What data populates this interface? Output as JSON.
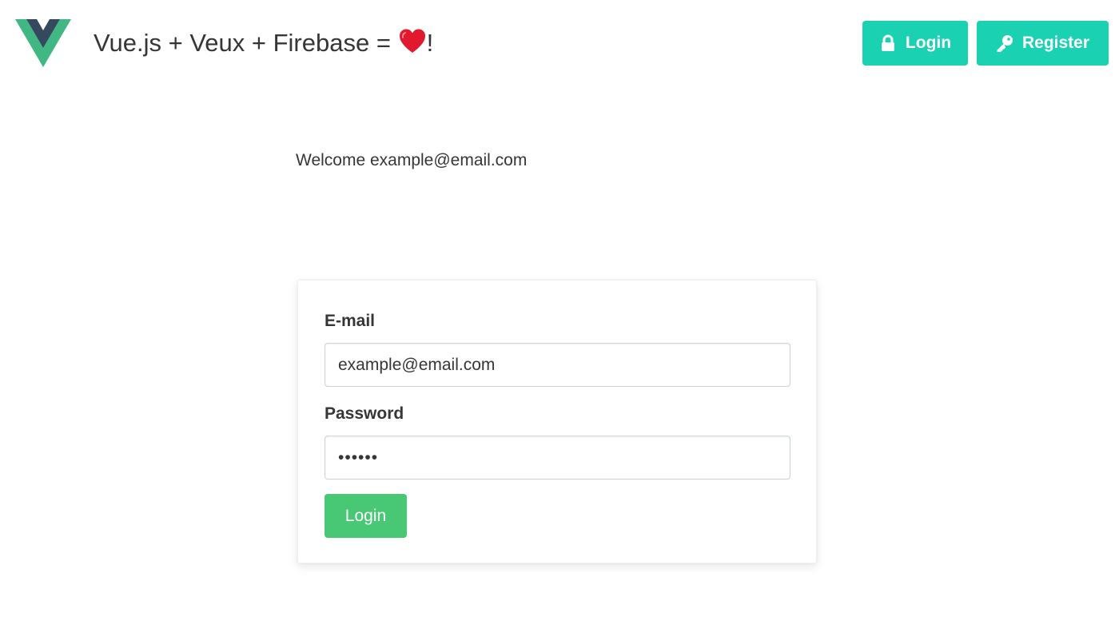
{
  "header": {
    "title_prefix": "Vue.js + Veux + Firebase = ",
    "title_suffix": "!",
    "logo_icon": "vue-logo-icon",
    "heart_icon": "red-heart-icon",
    "buttons": [
      {
        "label": "Login",
        "icon": "lock-icon"
      },
      {
        "label": "Register",
        "icon": "key-icon"
      }
    ]
  },
  "main": {
    "welcome_text": "Welcome example@email.com"
  },
  "form": {
    "email_label": "E-mail",
    "email_value": "example@email.com",
    "password_label": "Password",
    "password_value": "••••••",
    "submit_label": "Login"
  },
  "colors": {
    "nav_button_bg": "#1ad1b1",
    "submit_button_bg": "#48c774",
    "vue_green": "#41b883",
    "vue_dark": "#35495e",
    "heart_red": "#e0192f"
  }
}
